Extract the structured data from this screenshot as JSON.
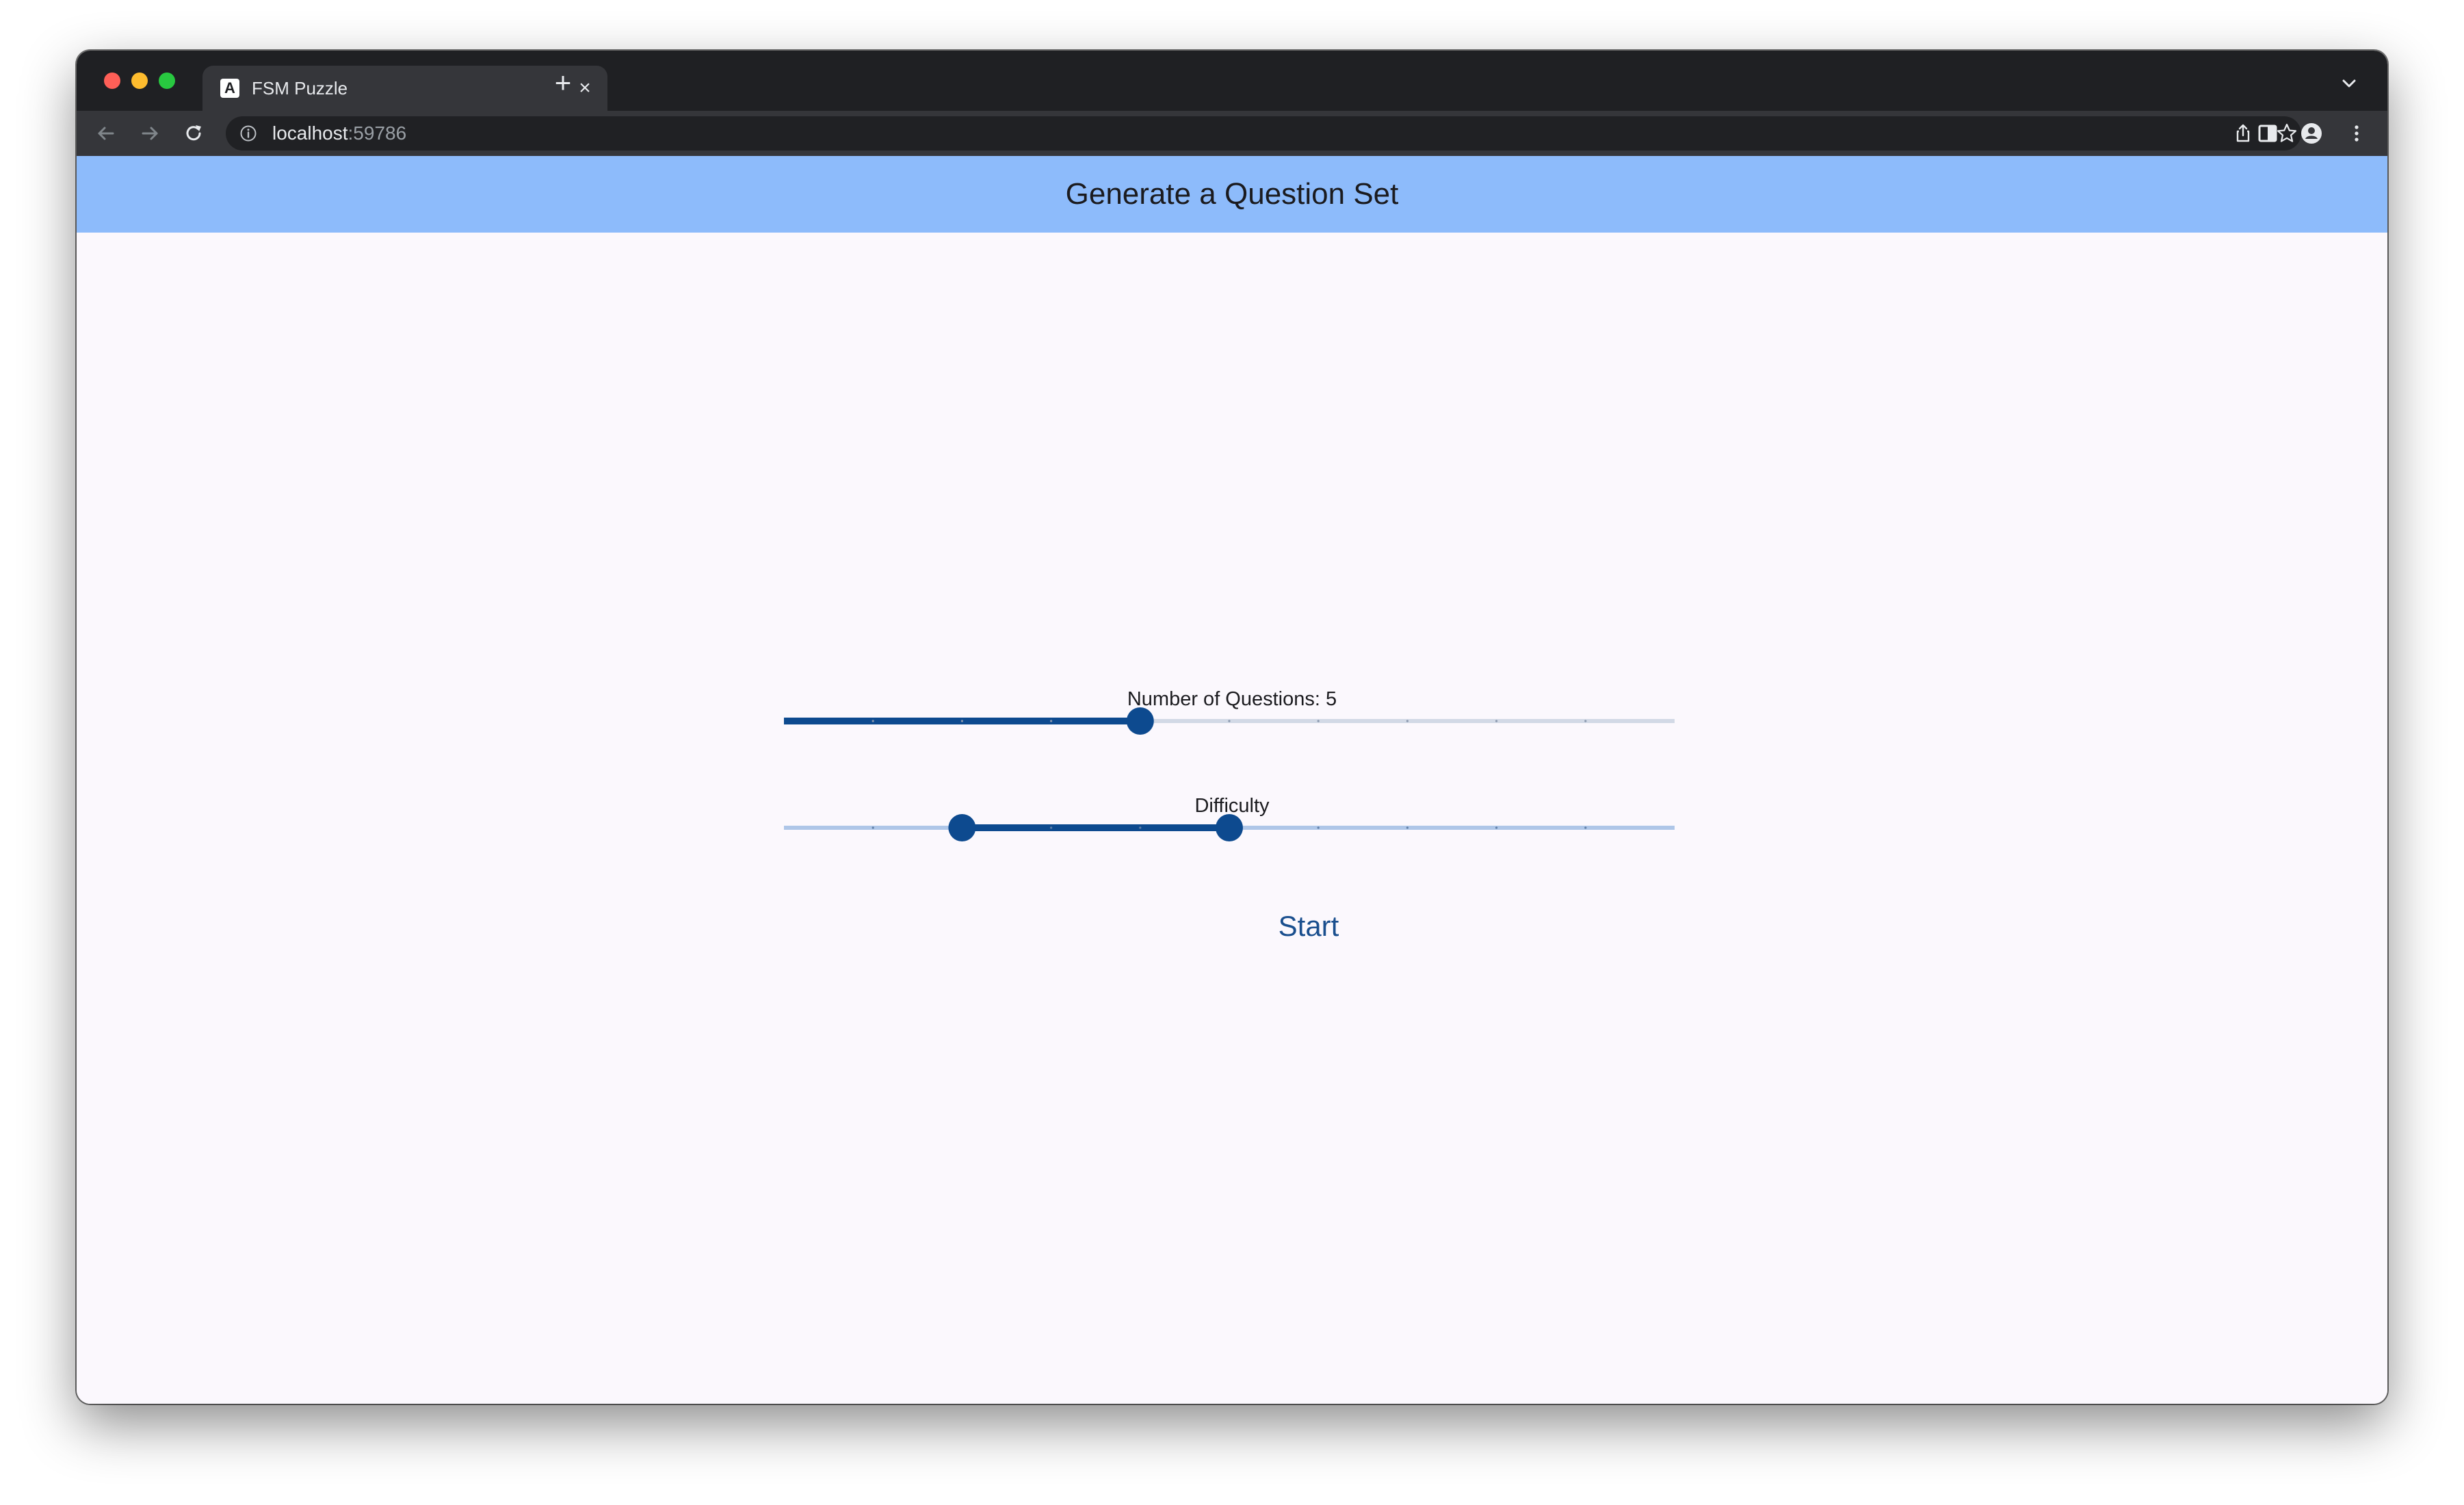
{
  "browser": {
    "tab": {
      "favicon_letter": "A",
      "title": "FSM Puzzle"
    },
    "address_bar": {
      "host": "localhost",
      "port": ":59786"
    },
    "icons": {
      "back": "arrow-left-icon",
      "forward": "arrow-right-icon",
      "reload": "reload-icon",
      "site_info": "info-icon",
      "share": "share-icon",
      "bookmark": "star-icon",
      "side_panel": "side-panel-icon",
      "profile": "profile-icon",
      "menu": "kebab-menu-icon",
      "new_tab": "plus-icon",
      "tab_close": "close-icon",
      "tab_search": "chevron-down-icon"
    }
  },
  "app": {
    "header_title": "Generate a Question Set",
    "questions_slider": {
      "label": "Number of Questions: 5",
      "min": 1,
      "max": 11,
      "divisions": 10,
      "value": 5
    },
    "difficulty_slider": {
      "label": "Difficulty",
      "min": 0,
      "max": 10,
      "divisions": 10,
      "start": 2,
      "end": 5
    },
    "start_button": "Start"
  },
  "colors": {
    "header_bg": "#8dbbfb",
    "slider_active": "#0d4a8f",
    "slider_inactive_q": "#d2d9e6",
    "slider_inactive_d": "#aec6e8",
    "page_bg": "#fbf8fd",
    "button_text": "#1a4f8e"
  }
}
